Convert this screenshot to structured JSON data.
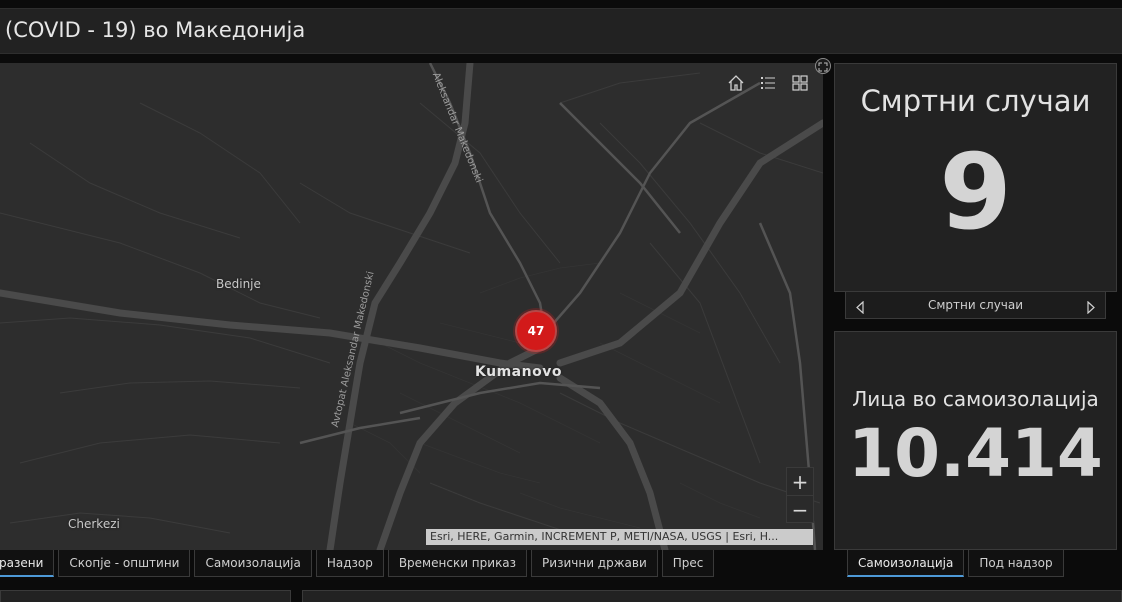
{
  "header": {
    "title": "(COVID - 19) во Македонија"
  },
  "map": {
    "places": {
      "bedinje": "Bedinje",
      "kumanovo": "Kumanovo",
      "cherkezi": "Cherkezi"
    },
    "roads": {
      "road1": "Aleksandar Makedonski",
      "road2": "Avtopat Aleksandar Makedonski"
    },
    "cluster_count": "47",
    "attribution": "Esri, HERE, Garmin, INCREMENT P, METI/NASA, USGS | Esri, H...",
    "zoom_in": "+",
    "zoom_out": "−",
    "tools": [
      "home-icon",
      "legend-icon",
      "basemap-gallery-icon"
    ]
  },
  "map_tabs": [
    {
      "label": "разени",
      "active": true
    },
    {
      "label": "Скопје - општини"
    },
    {
      "label": "Самоизолација"
    },
    {
      "label": "Надзор"
    },
    {
      "label": "Временски приказ"
    },
    {
      "label": "Ризични држави"
    },
    {
      "label": "Прес"
    }
  ],
  "indicator_deaths": {
    "title": "Смртни случаи",
    "value": "9",
    "pager_label": "Смртни случаи"
  },
  "indicator_isolation": {
    "title": "Лица во самоизолација",
    "value": "10.414"
  },
  "right_tabs": [
    {
      "label": "Самоизолација",
      "active": true
    },
    {
      "label": "Под надзор"
    }
  ],
  "colors": {
    "background": "#0b0b0b",
    "panel": "#222222",
    "cluster": "#d21a1a",
    "active_tab_underline": "#4e9ad8"
  }
}
